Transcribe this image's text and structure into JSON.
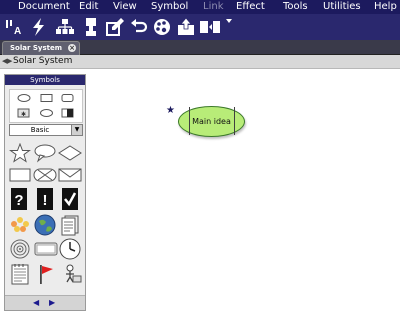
{
  "menu": {
    "items": [
      "Document",
      "Edit",
      "View",
      "Symbol",
      "Link",
      "Effect",
      "Tools",
      "Utilities",
      "Help"
    ]
  },
  "toolbar": {
    "icons": [
      "text-size-icon",
      "lightning-icon",
      "hierarchy-icon",
      "callout-icon",
      "edit-icon",
      "undo-icon",
      "palette-icon",
      "export-icon",
      "layout-icon"
    ]
  },
  "tab": {
    "label": "Solar System"
  },
  "breadcrumb": {
    "label": "Solar System"
  },
  "symbols_panel": {
    "title": "Symbols",
    "dropdown_value": "Basic"
  },
  "canvas": {
    "node_label": "Main idea"
  },
  "colors": {
    "menubar": "#1c1a5e",
    "toolbar": "#2a286e",
    "node_fill": "#b8ec78"
  }
}
